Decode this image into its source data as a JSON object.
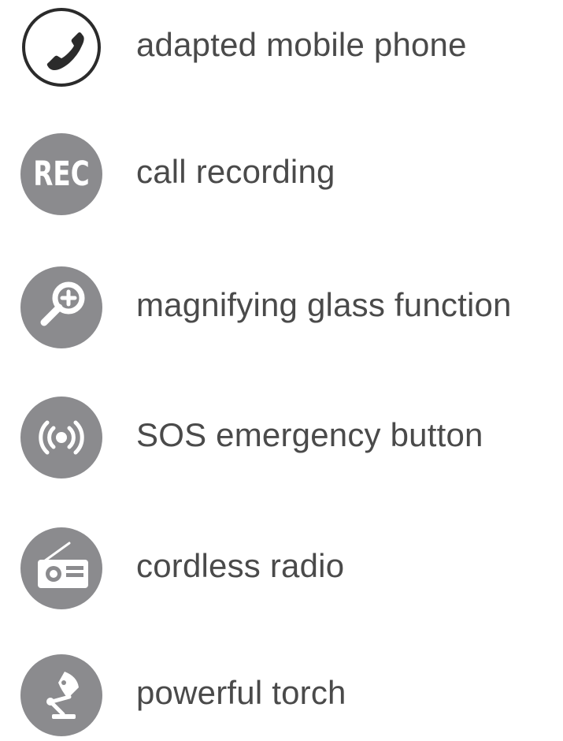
{
  "colors": {
    "icon_fill": "#8b8b8e",
    "icon_glyph": "#ffffff",
    "outline": "#2b2b2b",
    "text": "#4a4a4a"
  },
  "features": [
    {
      "icon": "phone-icon",
      "label": "adapted mobile phone"
    },
    {
      "icon": "rec-icon",
      "label": "call recording",
      "icon_text": "REC"
    },
    {
      "icon": "magnifier-icon",
      "label": "magnifying glass function"
    },
    {
      "icon": "sos-broadcast-icon",
      "label": "SOS emergency button"
    },
    {
      "icon": "radio-icon",
      "label": "cordless radio"
    },
    {
      "icon": "torch-lamp-icon",
      "label": "powerful torch"
    }
  ]
}
